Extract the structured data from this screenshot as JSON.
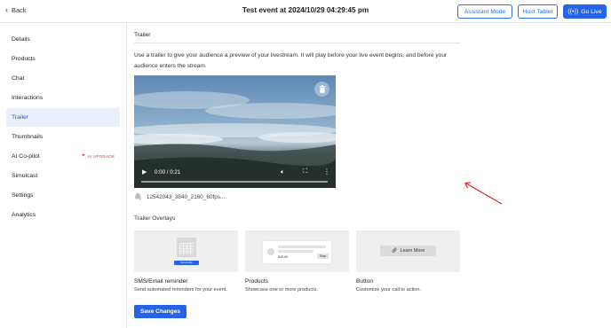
{
  "header": {
    "back_label": "Back",
    "title": "Test event at 2024/10/29 04:29:45 pm",
    "assistant_mode_label": "Assistant Mode",
    "host_tablet_label": "Host Tablet",
    "go_live_label": "Go Live"
  },
  "sidebar": {
    "items": [
      {
        "label": "Details"
      },
      {
        "label": "Products"
      },
      {
        "label": "Chat"
      },
      {
        "label": "Interactions"
      },
      {
        "label": "Trailer",
        "active": true
      },
      {
        "label": "Thumbnails"
      },
      {
        "label": "AI Co-pilot",
        "badge": "AI UPGRADE"
      },
      {
        "label": "Simulcast"
      },
      {
        "label": "Settings"
      },
      {
        "label": "Analytics"
      }
    ]
  },
  "main": {
    "section_title": "Trailer",
    "description": "Use a trailer to give your audience a preview of your livestream. It will play before your live event begins, and before your audience enters the stream.",
    "video": {
      "time": "0:00 / 0:21",
      "progress": 0
    },
    "file_name": "12542043_3840_2160_60fps....",
    "overlays_title": "Trailer Overlays",
    "overlays": [
      {
        "name": "SMS/Email reminder",
        "description": "Send automated reminders for your event.",
        "preview_button": "Remind Me"
      },
      {
        "name": "Products",
        "description": "Showcase one or more products.",
        "preview_price": "$45.00",
        "preview_button": "Shop"
      },
      {
        "name": "Button",
        "description": "Customize your call to action.",
        "preview_button": "Learn More"
      }
    ],
    "save_label": "Save Changes"
  },
  "colors": {
    "primary": "#2563eb",
    "active_bg": "#e9f0fb",
    "badge": "#d63a3a",
    "annotation_arrow": "#d62b2b"
  },
  "icons": [
    "chevron-left-icon",
    "broadcast-icon",
    "trash-icon",
    "play-icon",
    "volume-icon",
    "fullscreen-icon",
    "more-vertical-icon",
    "paperclip-icon",
    "link-icon",
    "sparkle-icon"
  ]
}
